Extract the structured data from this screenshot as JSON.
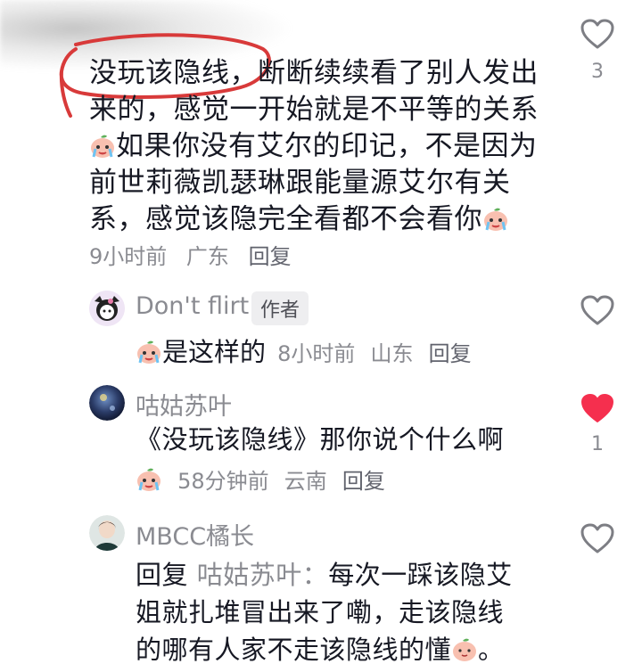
{
  "comments": [
    {
      "text_line1": "没玩该隐线，断断续续看了别人发出",
      "text_line2": "来的，感觉一开始就是不平等的关系",
      "text_line3": "如果你没有艾尔的印记，不是因为",
      "text_line4": "前世莉薇凯瑟琳跟能量源艾尔有关",
      "text_line5": "系，感觉该隐完全看都不会看你",
      "time": "9小时前",
      "location": "广东",
      "reply_label": "回复",
      "likes": "3"
    },
    {
      "username": "Don't flirt",
      "author_tag": "作者",
      "text": "是这样的",
      "time": "8小时前",
      "location": "山东",
      "reply_label": "回复"
    },
    {
      "username": "咕姑苏叶",
      "text": "《没玩该隐线》那你说个什么啊",
      "time": "58分钟前",
      "location": "云南",
      "reply_label": "回复",
      "likes": "1"
    },
    {
      "username": "MBCC橘长",
      "reply_prefix": "回复",
      "reply_target": "咕姑苏叶：",
      "text_line1": "每次一踩该隐艾",
      "text_line2": "姐就扎堆冒出来了嘞，走该隐线",
      "text_line3": "的哪有人家不走该隐线的懂",
      "text_end": "。"
    }
  ],
  "colors": {
    "liked_heart": "#f52f4e",
    "outline_heart": "#7d7e84",
    "circle_mark": "#d83a3a"
  }
}
